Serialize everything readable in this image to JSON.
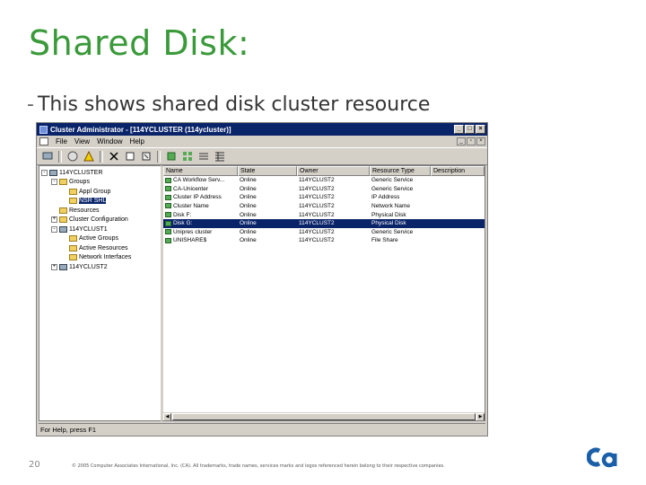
{
  "slide": {
    "title": "Shared Disk:",
    "bullet_dash": "-",
    "bullet": "This shows shared disk cluster resource",
    "page_number": "20",
    "copyright": "© 2005 Computer Associates International, Inc. (CA). All trademarks, trade names, services marks and logos referenced herein belong to their respective companies."
  },
  "window": {
    "title": "Cluster Administrator - [114YCLUSTER (114ycluster)]",
    "menu": [
      "File",
      "View",
      "Window",
      "Help"
    ],
    "status": "For Help, press F1"
  },
  "tree": [
    {
      "label": "114YCLUSTER",
      "indent": 0,
      "expander": "-",
      "icon": "pc"
    },
    {
      "label": "Groups",
      "indent": 1,
      "expander": "-",
      "icon": "folder"
    },
    {
      "label": "Appl Group",
      "indent": 2,
      "expander": "",
      "icon": "folder"
    },
    {
      "label": "NSR SHL",
      "indent": 2,
      "expander": "",
      "icon": "folder",
      "selected": true
    },
    {
      "label": "Resources",
      "indent": 1,
      "expander": "",
      "icon": "folder"
    },
    {
      "label": "Cluster Configuration",
      "indent": 1,
      "expander": "+",
      "icon": "folder"
    },
    {
      "label": "114YCLUST1",
      "indent": 1,
      "expander": "-",
      "icon": "pc"
    },
    {
      "label": "Active Groups",
      "indent": 2,
      "expander": "",
      "icon": "folder"
    },
    {
      "label": "Active Resources",
      "indent": 2,
      "expander": "",
      "icon": "folder"
    },
    {
      "label": "Network Interfaces",
      "indent": 2,
      "expander": "",
      "icon": "folder"
    },
    {
      "label": "114YCLUST2",
      "indent": 1,
      "expander": "+",
      "icon": "pc"
    }
  ],
  "list": {
    "columns": [
      "Name",
      "State",
      "Owner",
      "Resource Type",
      "Description"
    ],
    "rows": [
      {
        "name": "CA Workflow Serv...",
        "state": "Online",
        "owner": "114YCLUST2",
        "type": "Generic Service",
        "desc": ""
      },
      {
        "name": "CA-Unicenter",
        "state": "Online",
        "owner": "114YCLUST2",
        "type": "Generic Service",
        "desc": ""
      },
      {
        "name": "Cluster IP Address",
        "state": "Online",
        "owner": "114YCLUST2",
        "type": "IP Address",
        "desc": ""
      },
      {
        "name": "Cluster Name",
        "state": "Online",
        "owner": "114YCLUST2",
        "type": "Network Name",
        "desc": ""
      },
      {
        "name": "Disk F:",
        "state": "Online",
        "owner": "114YCLUST2",
        "type": "Physical Disk",
        "desc": ""
      },
      {
        "name": "Disk G:",
        "state": "Online",
        "owner": "114YCLUST2",
        "type": "Physical Disk",
        "desc": "",
        "selected": true
      },
      {
        "name": "Unipres cluster",
        "state": "Online",
        "owner": "114YCLUST2",
        "type": "Generic Service",
        "desc": ""
      },
      {
        "name": "UNISHARE$",
        "state": "Online",
        "owner": "114YCLUST2",
        "type": "File Share",
        "desc": ""
      }
    ]
  },
  "toolbar_icons": [
    "connect-icon",
    "properties-icon",
    "warning-icon",
    "delete-icon",
    "bring-online-icon",
    "take-offline-icon",
    "large-icons-icon",
    "small-icons-icon",
    "list-view-icon",
    "details-view-icon"
  ],
  "logo_colors": {
    "primary": "#1a5fa8"
  }
}
